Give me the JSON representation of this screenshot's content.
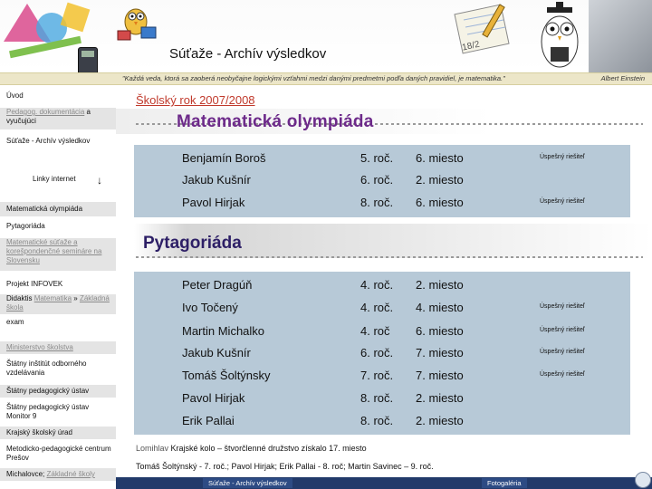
{
  "header": {
    "site_title": "Súťaže - Archív výsledkov",
    "motto": "\"Každá veda, ktorá sa zaoberá neobyčajne logickými vzťahmi medzi danými predmetmi podľa daných pravidiel, je matematika.\"",
    "motto_author": "Albert Einstein",
    "notebook_text": "18/2"
  },
  "sidebar": {
    "uvod": "Úvod",
    "pedagog_link": "Pedagog. dokumentácia",
    "pedagog_tail": "a vyučujúci",
    "sutaze_archiv": "Súťaže - Archív výsledkov",
    "linky_internet": "Linky internet",
    "linky_arrow": "↓",
    "mat_olympiada": "Matematická olympiáda",
    "pytagoriada": "Pytagoriáda",
    "mat_sutaze": "Matematické súťaže a korešpondenčné semináre na Slovensku",
    "projekt": "Projekt INFOVEK",
    "didaktis_prefix": "Didaktis",
    "didaktis_link": "Matematika",
    "didaktis_suffix": "»",
    "didaktis_link2": "Základná škola",
    "exam": "exam",
    "ministerstvo": "Ministerstvo školstva",
    "statny_institut": "Štátny inštitút odborného vzdelávania",
    "statny_ped": "Štátny pedagogický ústav",
    "statny_monitor": "Štátny pedagogický ústav Monitor 9",
    "krajsky": "Krajský školský úrad",
    "metodicko": "Metodicko-pedagogické centrum Prešov",
    "michalovce_prefix": "Michalovce;",
    "michalovce_link": "Základné školy"
  },
  "main": {
    "year_label": "Školský rok 2007/2008",
    "mo_title": "Matematická olympiáda",
    "pyta_title": "Pytagoriáda",
    "mo_rows": [
      {
        "name": "Benjamín Boroš",
        "grade": "5. roč.",
        "place": "6. miesto",
        "note": "Úspešný riešiteľ"
      },
      {
        "name": "Jakub Kušnír",
        "grade": "6. roč.",
        "place": "2. miesto",
        "note": ""
      },
      {
        "name": "Pavol Hirjak",
        "grade": "8. roč.",
        "place": "6. miesto",
        "note": "Úspešný riešiteľ"
      }
    ],
    "pyta_rows": [
      {
        "name": "Peter Dragúň",
        "grade": "4. roč.",
        "place": "2. miesto",
        "note": ""
      },
      {
        "name": "Ivo Točený",
        "grade": "4. roč.",
        "place": "4. miesto",
        "note": "Úspešný riešiteľ"
      },
      {
        "name": "Martin Michalko",
        "grade": "4. roč",
        "place": "6. miesto",
        "note": "Úspešný riešiteľ"
      },
      {
        "name": "Jakub Kušnír",
        "grade": "6. roč.",
        "place": "7. miesto",
        "note": "Úspešný riešiteľ"
      },
      {
        "name": "Tomáš Šoltýnsky",
        "grade": "7. roč.",
        "place": "7. miesto",
        "note": "Úspešný riešiteľ"
      },
      {
        "name": "Pavol Hirjak",
        "grade": "8. roč.",
        "place": "2. miesto",
        "note": ""
      },
      {
        "name": "Erik Pallai",
        "grade": "8. roč.",
        "place": "2. miesto",
        "note": ""
      }
    ],
    "footnote_link": "Lomihlav",
    "footnote_text": " Krajské kolo – štvorčlenné družstvo získalo 17. miesto",
    "footnote2": "Tomáš Šoltýnský - 7. roč.; Pavol Hirjak; Erik Pallai - 8. roč; Martin Savinec – 9. roč."
  },
  "bottom": {
    "home_button": "Súťaže - Archív výsledkov",
    "gallery_button": "Fotogaléria"
  },
  "colors": {
    "table_bg": "#b7c9d7",
    "year_red": "#c0392b",
    "mo_purple": "#6d2a8a",
    "bottom_navy": "#223a6a"
  }
}
